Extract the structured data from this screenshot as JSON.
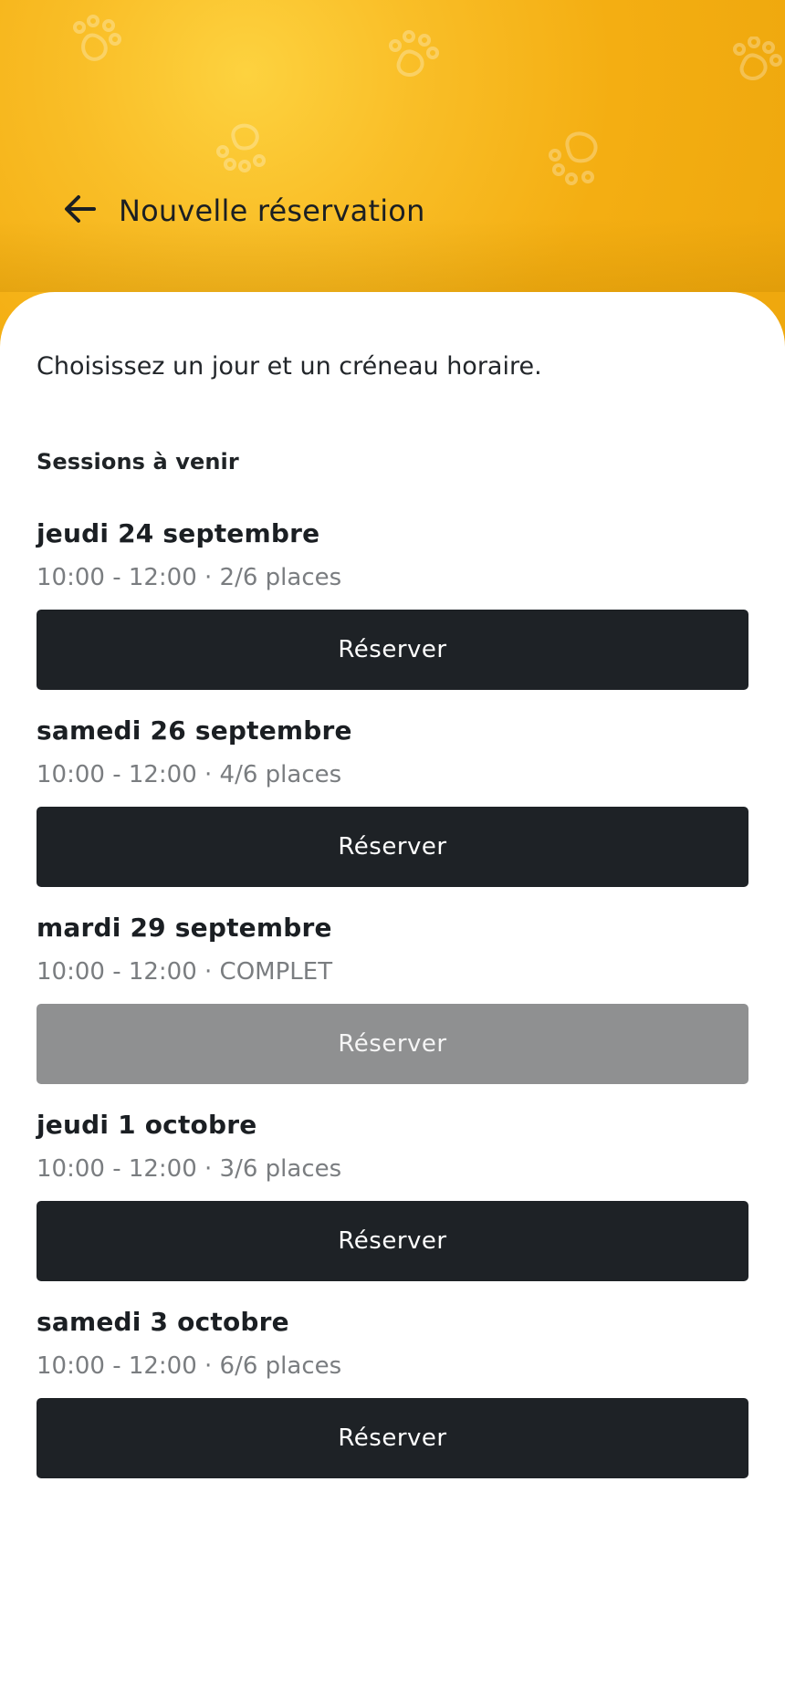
{
  "header": {
    "title": "Nouvelle réservation",
    "back_icon": "arrow-left-icon",
    "background_color": "#f6b417"
  },
  "intro_text": "Choisissez un jour et un créneau horaire.",
  "section_title": "Sessions à venir",
  "sessions": [
    {
      "date": "jeudi 24 septembre",
      "info": "10:00 - 12:00 · 2/6 places",
      "button": "Réserver",
      "available": true
    },
    {
      "date": "samedi 26 septembre",
      "info": "10:00 - 12:00 · 4/6 places",
      "button": "Réserver",
      "available": true
    },
    {
      "date": "mardi 29 septembre",
      "info": "10:00 - 12:00 · COMPLET",
      "button": "Réserver",
      "available": false
    },
    {
      "date": "jeudi 1 octobre",
      "info": "10:00 - 12:00 · 3/6 places",
      "button": "Réserver",
      "available": true
    },
    {
      "date": "samedi 3 octobre",
      "info": "10:00 - 12:00 · 6/6 places",
      "button": "Réserver",
      "available": true
    }
  ],
  "colors": {
    "button_active": "#1e2226",
    "button_disabled": "#8f9091",
    "text_secondary": "#7a7d80"
  }
}
